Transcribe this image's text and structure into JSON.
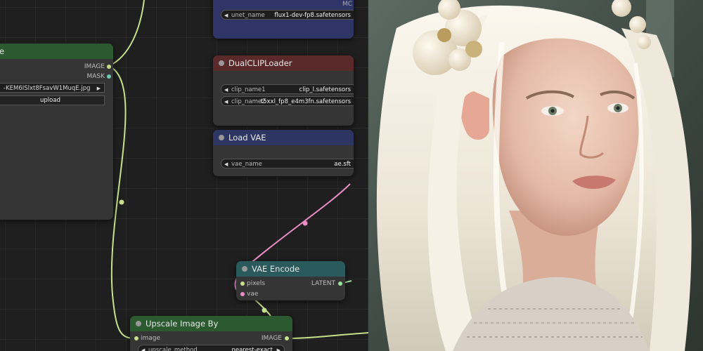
{
  "nodes": {
    "load_image": {
      "image_output": "IMAGE",
      "mask_output": "MASK",
      "filename": "-KEM6ISlxt8FsavW1MuqE.jpg",
      "upload_label": "upload"
    },
    "unet_loader": {
      "corner_text": "MC",
      "widget_name": "unet_name",
      "widget_value": "flux1-dev-fp8.safetensors"
    },
    "dual_clip_loader": {
      "title": "DualCLIPLoader",
      "clip1_name": "clip_name1",
      "clip1_value": "clip_l.safetensors",
      "clip2_name": "clip_name2",
      "clip2_value": "t5xxl_fp8_e4m3fn.safetensors"
    },
    "load_vae": {
      "title": "Load VAE",
      "widget_name": "vae_name",
      "widget_value": "ae.sft"
    },
    "vae_encode": {
      "title": "VAE Encode",
      "input_pixels": "pixels",
      "input_vae": "vae",
      "output_latent": "LATENT"
    },
    "upscale_image": {
      "title": "Upscale Image By",
      "input_image": "image",
      "output_image": "IMAGE",
      "method_name": "upscale_method",
      "method_value": "nearest-exact"
    }
  },
  "colors": {
    "canvas_bg": "#1f1f1f",
    "node_body": "#353535",
    "green_header": "#2c5a30",
    "red_header": "#5a2a2a",
    "blue_header": "#2d3563",
    "teal_header": "#2a5a5c",
    "image_wire": "#c8e08c",
    "vae_wire": "#ea8ec8",
    "latent_dot": "#9be39b"
  },
  "preview": {
    "subject": "portrait of a woman with long platinum hair and pearl hair ornament"
  }
}
